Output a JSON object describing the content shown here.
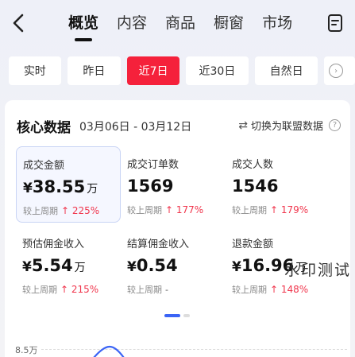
{
  "header": {
    "tabs": [
      {
        "label": "概览",
        "active": true
      },
      {
        "label": "内容"
      },
      {
        "label": "商品"
      },
      {
        "label": "橱窗"
      },
      {
        "label": "市场"
      }
    ]
  },
  "filters": [
    "实时",
    "昨日",
    "近7日",
    "近30日",
    "自然日"
  ],
  "active_filter": "近7日",
  "core": {
    "title": "核心数据",
    "date_range": "03月06日 - 03月12日",
    "switch_label": "切换为联盟数据"
  },
  "metrics": [
    {
      "label": "成交金额",
      "currency": "¥",
      "value": "38.55",
      "unit": "万",
      "compare_label": "较上周期",
      "change": "↑ 225%"
    },
    {
      "label": "成交订单数",
      "currency": "",
      "value": "1569",
      "unit": "",
      "compare_label": "较上周期",
      "change": "↑ 177%"
    },
    {
      "label": "成交人数",
      "currency": "",
      "value": "1546",
      "unit": "",
      "compare_label": "较上周期",
      "change": "↑ 179%"
    },
    {
      "label": "预估佣金收入",
      "currency": "¥",
      "value": "5.54",
      "unit": "万",
      "compare_label": "较上周期",
      "change": "↑ 215%"
    },
    {
      "label": "结算佣金收入",
      "currency": "¥",
      "value": "0.54",
      "unit": "",
      "compare_label": "较上周期",
      "change": "-"
    },
    {
      "label": "退款金额",
      "currency": "¥",
      "value": "16.96",
      "unit": "万",
      "compare_label": "较上周期",
      "change": "↑ 148%"
    }
  ],
  "watermark": "水印测试",
  "chart": {
    "y_tick": "8.5万"
  },
  "colors": {
    "accent": "#f5213b",
    "increase": "#f0364d",
    "pager": "#3b64f5"
  }
}
